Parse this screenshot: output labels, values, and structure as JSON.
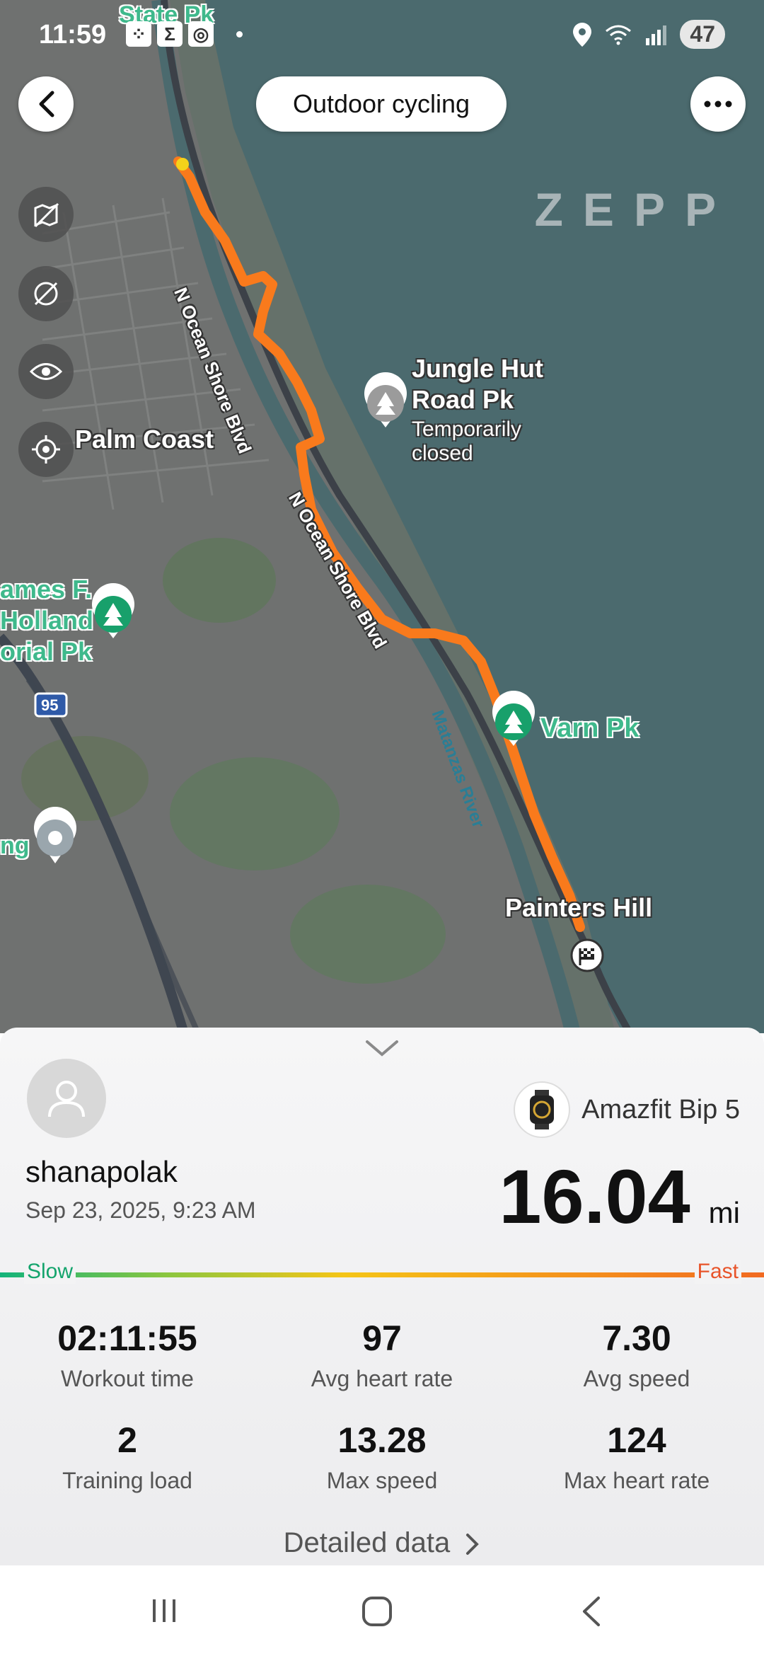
{
  "status_bar": {
    "time": "11:59",
    "battery": "47"
  },
  "header": {
    "title": "Outdoor cycling",
    "watermark": "ZEPP"
  },
  "map": {
    "labels": {
      "state_park": "State Pk",
      "palm_coast": "Palm Coast",
      "jungle_hut_1": "Jungle Hut",
      "jungle_hut_2": "Road Pk",
      "jungle_hut_status_1": "Temporarily",
      "jungle_hut_status_2": "closed",
      "james_1": "ames F.",
      "james_2": "Holland",
      "james_3": "orial Pk",
      "varn": "Varn Pk",
      "painters": "Painters Hill",
      "left_poi": "ng",
      "road_1": "N Ocean Shore Blvd",
      "road_2": "N Ocean Shore Blvd",
      "waterway": "Matanzas River",
      "interstate": "95"
    }
  },
  "workout": {
    "username": "shanapolak",
    "datetime": "Sep 23, 2025, 9:23 AM",
    "device": "Amazfit Bip 5",
    "distance": "16.04",
    "distance_unit": "mi",
    "pace_slow": "Slow",
    "pace_fast": "Fast",
    "stats": [
      {
        "value": "02:11:55",
        "label": "Workout time"
      },
      {
        "value": "97",
        "label": "Avg heart rate"
      },
      {
        "value": "7.30",
        "label": "Avg speed"
      },
      {
        "value": "2",
        "label": "Training load"
      },
      {
        "value": "13.28",
        "label": "Max speed"
      },
      {
        "value": "124",
        "label": "Max heart rate"
      }
    ],
    "detailed_label": "Detailed data"
  },
  "colors": {
    "route": "#f97a1c",
    "ocean": "#4b6a6e",
    "land": "#6f7170",
    "accent_green": "#14a46c",
    "accent_red": "#e8542a"
  }
}
